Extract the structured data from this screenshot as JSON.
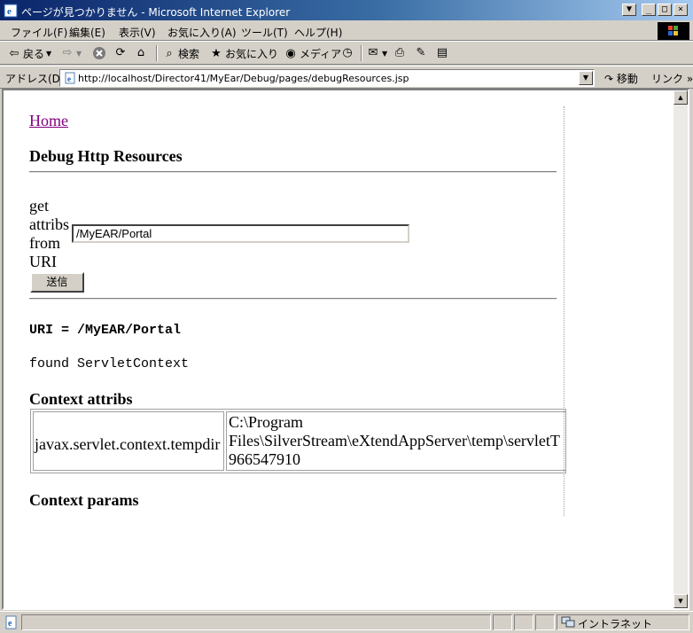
{
  "window": {
    "title": "ページが見つかりません - Microsoft Internet Explorer"
  },
  "menu": [
    "ファイル(F)",
    "編集(E)",
    "表示(V)",
    "お気に入り(A)",
    "ツール(T)",
    "ヘルプ(H)"
  ],
  "toolbar": {
    "back": "戻る",
    "search": "検索",
    "favorites": "お気に入り",
    "media": "メディア"
  },
  "address": {
    "label": "アドレス(D)",
    "url": "http://localhost/Director41/MyEar/Debug/pages/debugResources.jsp",
    "go": "移動",
    "links": "リンク"
  },
  "page": {
    "home_link": "Home",
    "heading": "Debug Http Resources",
    "form_label": "get attribs from URI",
    "uri_value": "/MyEAR/Portal",
    "submit": "送信",
    "uri_line": "URI = /MyEAR/Portal",
    "found_line": "found ServletContext",
    "context_attribs_heading": "Context attribs",
    "attribs": [
      {
        "key": "javax.servlet.context.tempdir",
        "value_line1": "C:\\Program",
        "value_line2": "Files\\SilverStream\\eXtendAppServer\\temp\\servletT",
        "value_line3": "966547910"
      }
    ],
    "context_params_heading": "Context params"
  },
  "status": {
    "zone": "イントラネット"
  }
}
